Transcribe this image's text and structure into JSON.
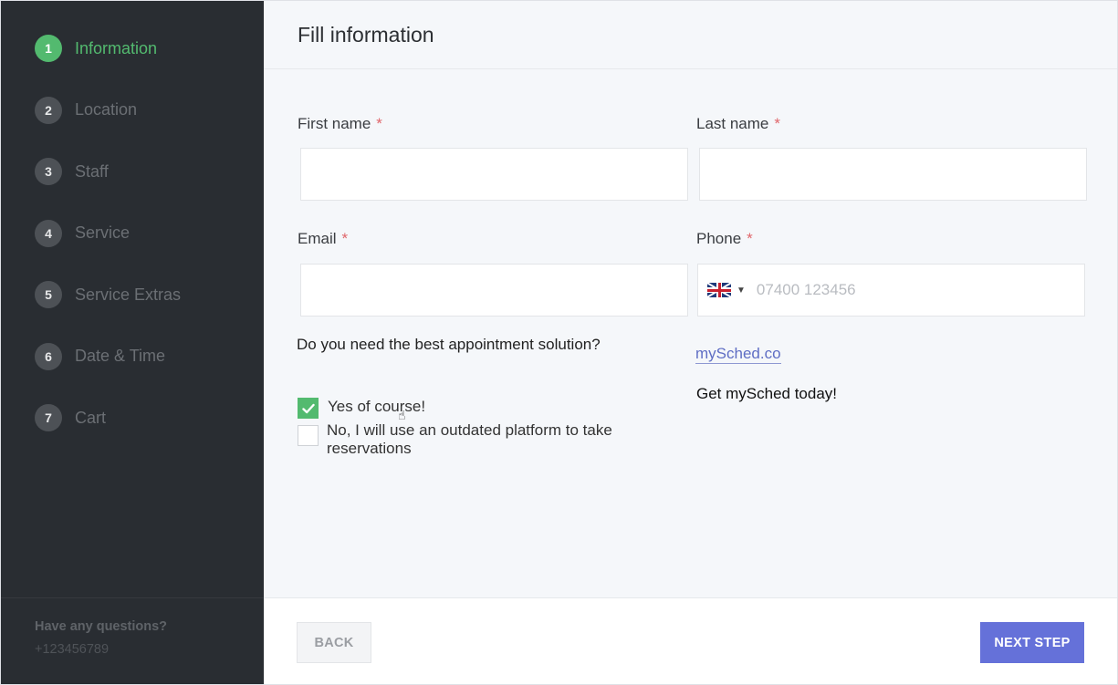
{
  "sidebar": {
    "steps": [
      {
        "num": "1",
        "label": "Information"
      },
      {
        "num": "2",
        "label": "Location"
      },
      {
        "num": "3",
        "label": "Staff"
      },
      {
        "num": "4",
        "label": "Service"
      },
      {
        "num": "5",
        "label": "Service Extras"
      },
      {
        "num": "6",
        "label": "Date & Time"
      },
      {
        "num": "7",
        "label": "Cart"
      }
    ],
    "active_step": "1",
    "footer": {
      "question": "Have any questions?",
      "phone": "+123456789"
    }
  },
  "header": {
    "title": "Fill information"
  },
  "form": {
    "required_marker": "*",
    "first_name": {
      "label": "First name",
      "value": ""
    },
    "last_name": {
      "label": "Last name",
      "value": ""
    },
    "email": {
      "label": "Email",
      "value": ""
    },
    "phone": {
      "label": "Phone",
      "placeholder": "07400 123456",
      "country_flag": "uk-flag-icon",
      "value": ""
    },
    "question": "Do you need the best appointment solution?",
    "options": [
      {
        "label": "Yes of course!",
        "checked": true
      },
      {
        "label": "No, I will use an outdated platform to take reservations",
        "checked": false
      }
    ],
    "link_text": "mySched.co",
    "tagline": "Get mySched today!"
  },
  "actions": {
    "back_label": "BACK",
    "next_label": "NEXT STEP"
  },
  "colors": {
    "sidebar_bg": "#292d32",
    "accent_green": "#53ba6f",
    "primary_button": "#6571d9",
    "required": "#e0666b",
    "link": "#5f6ec4"
  }
}
